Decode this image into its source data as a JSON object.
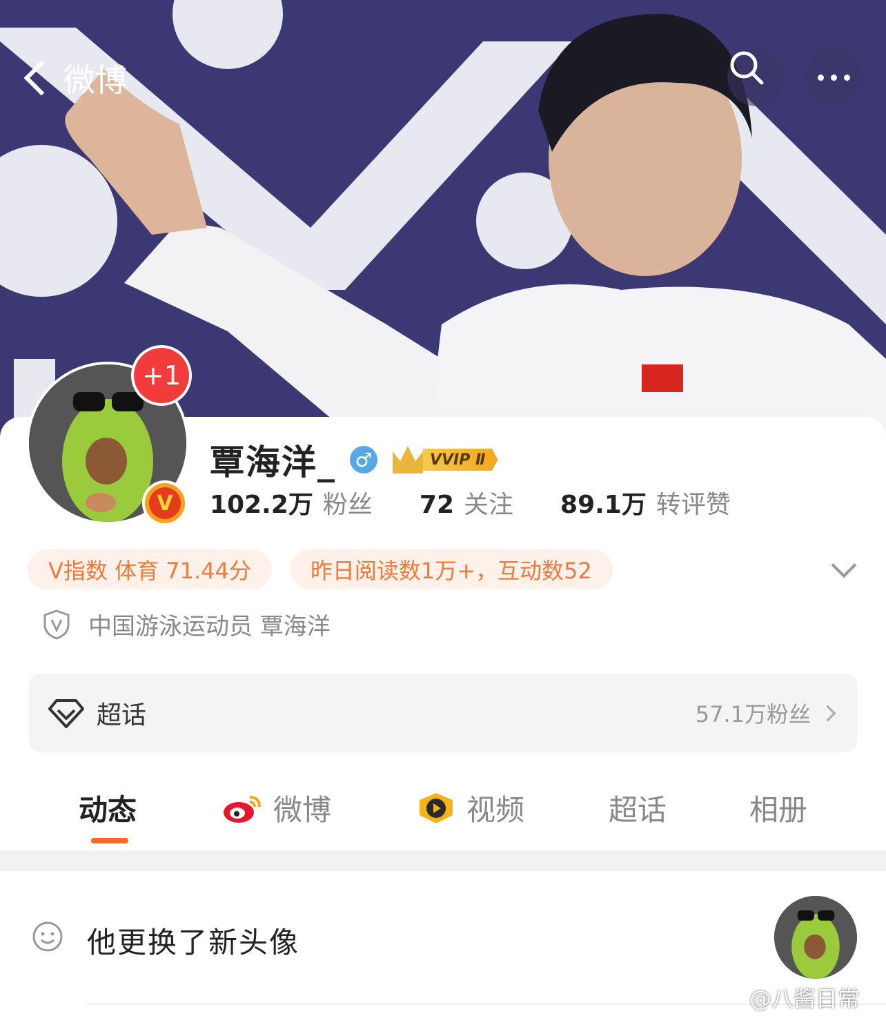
{
  "header": {
    "back_label": "微博",
    "icons": {
      "back": "chevron-left-icon",
      "search": "search-icon",
      "more": "more-dots-icon"
    }
  },
  "profile": {
    "avatar_badge": "+1",
    "verified_letter": "V",
    "username": "覃海洋_",
    "gender_symbol": "♂",
    "vvip_label": "VVIP Ⅱ",
    "stats": [
      {
        "num": "102.2万",
        "label": "粉丝"
      },
      {
        "num": "72",
        "label": "关注"
      },
      {
        "num": "89.1万",
        "label": "转评赞"
      }
    ],
    "chips": [
      "V指数 体育 71.44分",
      "昨日阅读数1万+，互动数52"
    ],
    "verification": "中国游泳运动员 覃海洋"
  },
  "supertopic": {
    "label": "超话",
    "fans": "57.1万粉丝"
  },
  "tabs": [
    {
      "label": "动态",
      "active": true
    },
    {
      "label": "微博",
      "active": false
    },
    {
      "label": "视频",
      "active": false
    },
    {
      "label": "超话",
      "active": false
    },
    {
      "label": "相册",
      "active": false
    }
  ],
  "feed": {
    "text": "他更换了新头像"
  },
  "watermark": "@八酱日常",
  "colors": {
    "accent": "#f36b21",
    "chip_bg": "#fdf1ea",
    "chip_text": "#ef7a3c",
    "banner": "#3a3672"
  }
}
